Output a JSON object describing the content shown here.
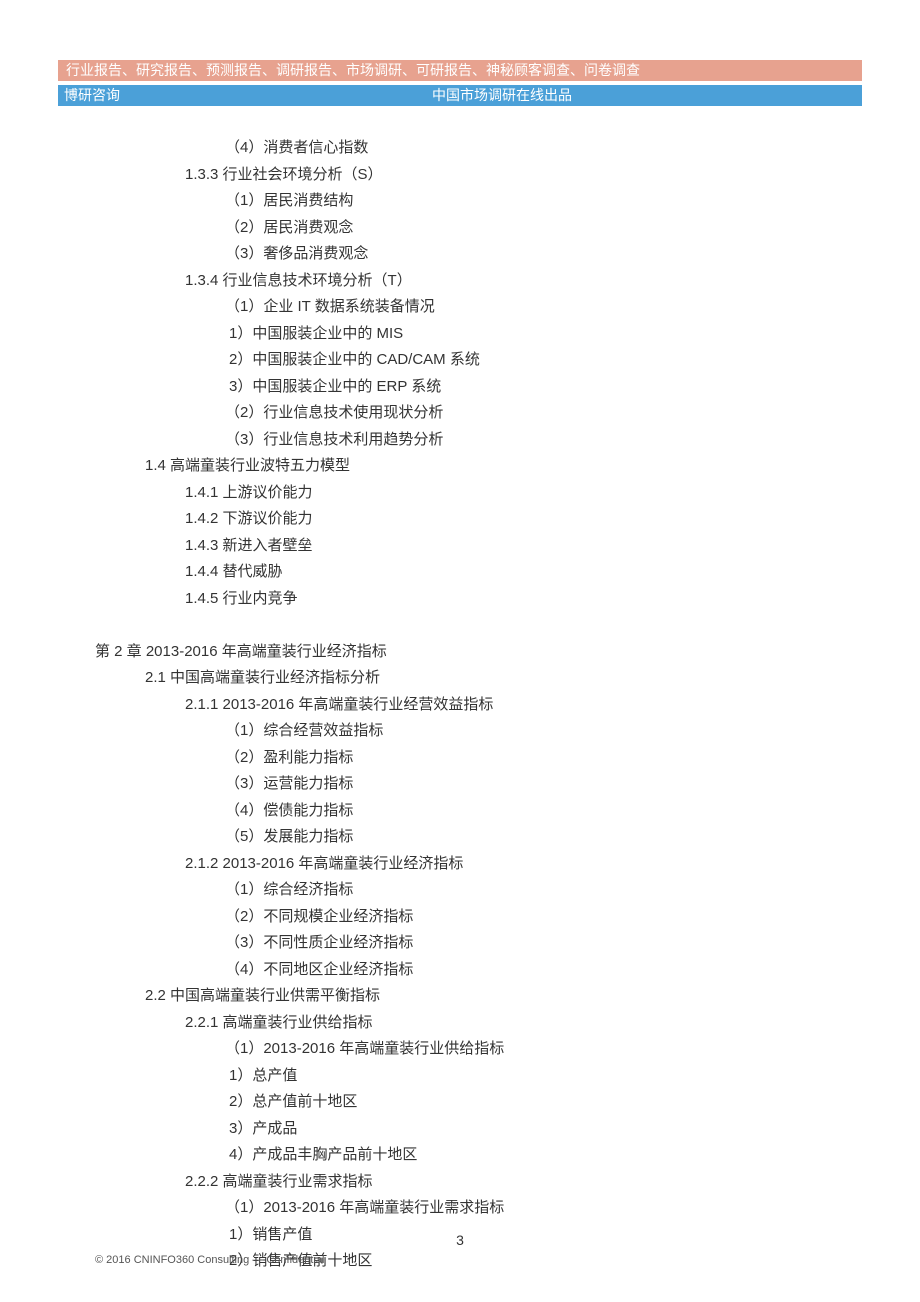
{
  "header": {
    "bar1": "行业报告、研究报告、预测报告、调研报告、市场调研、可研报告、神秘顾客调查、问卷调查",
    "bar2_left": "博研咨询",
    "bar2_right": "中国市场调研在线出品"
  },
  "toc": [
    {
      "indent": 3,
      "text": "（4）消费者信心指数"
    },
    {
      "indent": 2,
      "text": "1.3.3 行业社会环境分析（S）"
    },
    {
      "indent": 3,
      "text": "（1）居民消费结构"
    },
    {
      "indent": 3,
      "text": "（2）居民消费观念"
    },
    {
      "indent": 3,
      "text": "（3）奢侈品消费观念"
    },
    {
      "indent": 2,
      "text": "1.3.4 行业信息技术环境分析（T）"
    },
    {
      "indent": 3,
      "text": "（1）企业 IT 数据系统装备情况"
    },
    {
      "indent": 3,
      "sub": true,
      "text": "1）中国服装企业中的 MIS"
    },
    {
      "indent": 3,
      "sub": true,
      "text": "2）中国服装企业中的 CAD/CAM 系统"
    },
    {
      "indent": 3,
      "sub": true,
      "text": "3）中国服装企业中的 ERP 系统"
    },
    {
      "indent": 3,
      "text": "（2）行业信息技术使用现状分析"
    },
    {
      "indent": 3,
      "text": "（3）行业信息技术利用趋势分析"
    },
    {
      "indent": 1,
      "text": "1.4 高端童装行业波特五力模型"
    },
    {
      "indent": 2,
      "text": "1.4.1 上游议价能力"
    },
    {
      "indent": 2,
      "text": "1.4.2 下游议价能力"
    },
    {
      "indent": 2,
      "text": "1.4.3 新进入者壁垒"
    },
    {
      "indent": 2,
      "text": "1.4.4 替代威胁"
    },
    {
      "indent": 2,
      "text": "1.4.5 行业内竞争"
    },
    {
      "indent": 0,
      "blank": true,
      "text": ""
    },
    {
      "indent": 0,
      "text": "第 2 章 2013-2016 年高端童装行业经济指标"
    },
    {
      "indent": 1,
      "text": "2.1 中国高端童装行业经济指标分析"
    },
    {
      "indent": 2,
      "text": "2.1.1 2013-2016 年高端童装行业经营效益指标"
    },
    {
      "indent": 3,
      "text": "（1）综合经营效益指标"
    },
    {
      "indent": 3,
      "text": "（2）盈利能力指标"
    },
    {
      "indent": 3,
      "text": "（3）运营能力指标"
    },
    {
      "indent": 3,
      "text": "（4）偿债能力指标"
    },
    {
      "indent": 3,
      "text": "（5）发展能力指标"
    },
    {
      "indent": 2,
      "text": "2.1.2 2013-2016 年高端童装行业经济指标"
    },
    {
      "indent": 3,
      "text": "（1）综合经济指标"
    },
    {
      "indent": 3,
      "text": "（2）不同规模企业经济指标"
    },
    {
      "indent": 3,
      "text": "（3）不同性质企业经济指标"
    },
    {
      "indent": 3,
      "text": "（4）不同地区企业经济指标"
    },
    {
      "indent": 1,
      "text": "2.2 中国高端童装行业供需平衡指标"
    },
    {
      "indent": 2,
      "text": "2.2.1 高端童装行业供给指标"
    },
    {
      "indent": 3,
      "text": "（1）2013-2016 年高端童装行业供给指标"
    },
    {
      "indent": 3,
      "sub": true,
      "text": "1）总产值"
    },
    {
      "indent": 3,
      "sub": true,
      "text": "2）总产值前十地区"
    },
    {
      "indent": 3,
      "sub": true,
      "text": "3）产成品"
    },
    {
      "indent": 3,
      "sub": true,
      "text": "4）产成品丰胸产品前十地区"
    },
    {
      "indent": 2,
      "text": "2.2.2 高端童装行业需求指标"
    },
    {
      "indent": 3,
      "text": "（1）2013-2016 年高端童装行业需求指标"
    },
    {
      "indent": 3,
      "sub": true,
      "text": "1）销售产值"
    },
    {
      "indent": 3,
      "sub": true,
      "text": "2）销售产值前十地区"
    }
  ],
  "page_number": "3",
  "footer": "© 2016 CNINFO360 Consulting — Confidential"
}
